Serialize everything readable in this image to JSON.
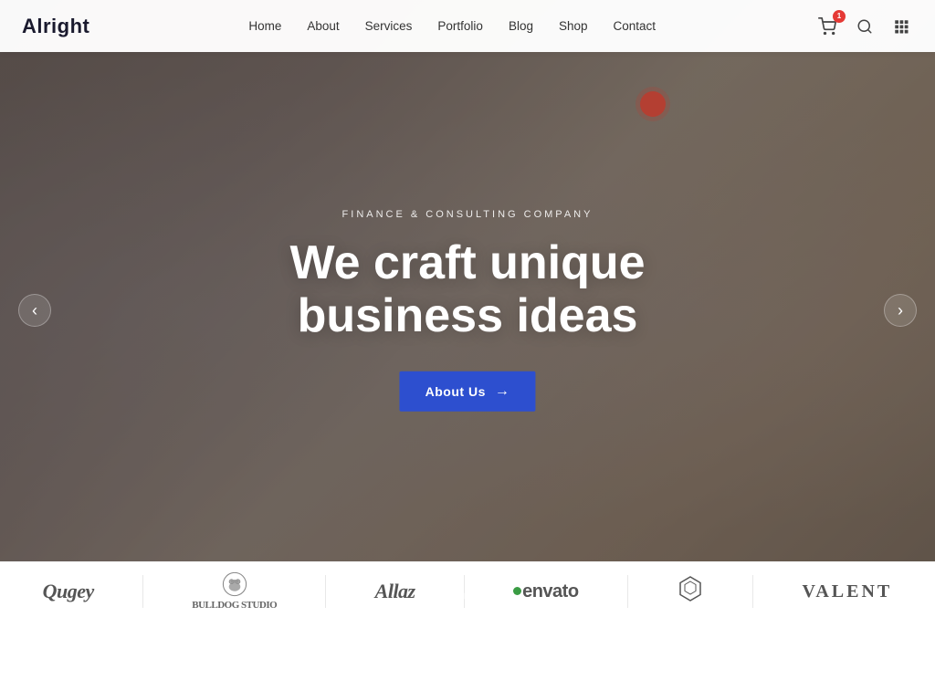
{
  "navbar": {
    "logo": "Alright",
    "nav_items": [
      {
        "label": "Home",
        "href": "#"
      },
      {
        "label": "About",
        "href": "#"
      },
      {
        "label": "Services",
        "href": "#"
      },
      {
        "label": "Portfolio",
        "href": "#"
      },
      {
        "label": "Blog",
        "href": "#"
      },
      {
        "label": "Shop",
        "href": "#"
      },
      {
        "label": "Contact",
        "href": "#"
      }
    ],
    "cart_count": "1"
  },
  "hero": {
    "subtitle": "Finance & Consulting Company",
    "title_line1": "We craft unique",
    "title_line2": "business ideas",
    "cta_label": "About Us",
    "cta_arrow": "→",
    "arrow_left": "‹",
    "arrow_right": "›",
    "dots": [
      {
        "active": true
      },
      {
        "active": false
      },
      {
        "active": false
      }
    ]
  },
  "logos": [
    {
      "label": "Qugey",
      "style": "serif"
    },
    {
      "label": "🦁 BULLDOG\nSTUDIO",
      "style": "small"
    },
    {
      "label": "Allaz",
      "style": "serif-italic"
    },
    {
      "label": "envato",
      "style": "envato"
    },
    {
      "label": "⬡",
      "style": "icon"
    },
    {
      "label": "VALENT",
      "style": "caps"
    }
  ],
  "icons": {
    "cart": "🛒",
    "search": "🔍",
    "grid": "⋮⋮"
  }
}
